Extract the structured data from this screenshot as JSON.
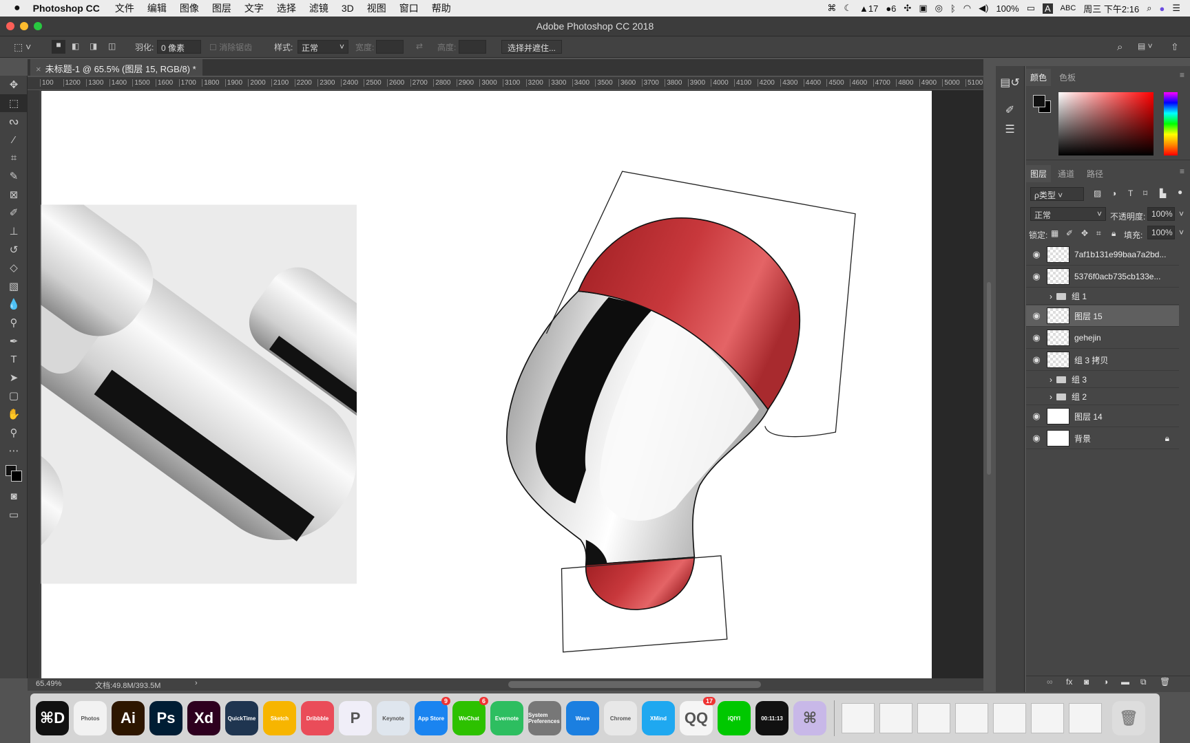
{
  "menubar": {
    "app": "Photoshop CC",
    "items": [
      "文件",
      "编辑",
      "图像",
      "图层",
      "文字",
      "选择",
      "滤镜",
      "3D",
      "视图",
      "窗口",
      "帮助"
    ],
    "status": {
      "notifications": "17",
      "wechat": "6",
      "battery": "100%",
      "input": "ABC",
      "clock": "周三 下午2:16"
    }
  },
  "window": {
    "title": "Adobe Photoshop CC 2018"
  },
  "options": {
    "feather_label": "羽化:",
    "feather_value": "0 像素",
    "antialias_label": "消除锯齿",
    "style_label": "样式:",
    "style_value": "正常",
    "width_label": "宽度:",
    "height_label": "高度:",
    "select_mask_button": "选择并遮住..."
  },
  "document": {
    "tab": "未标题-1 @ 65.5% (图层 15, RGB/8) *",
    "zoom": "65.49%",
    "doc_size": "文档:49.8M/393.5M",
    "status_arrow": "›"
  },
  "ruler": {
    "labels": [
      "100",
      "1200",
      "1300",
      "1400",
      "1500",
      "1600",
      "1700",
      "1800",
      "1900",
      "2000",
      "2100",
      "2200",
      "2300",
      "2400",
      "2500",
      "2600",
      "2700",
      "2800",
      "2900",
      "3000",
      "3100",
      "3200",
      "3300",
      "3400",
      "3500",
      "3600",
      "3700",
      "3800",
      "3900",
      "4000",
      "4100",
      "4200",
      "4300",
      "4400",
      "4500",
      "4600",
      "4700",
      "4800",
      "4900",
      "5000",
      "5100"
    ]
  },
  "tools": [
    "move",
    "rect-marquee",
    "lasso",
    "magic-wand",
    "crop",
    "eyedropper",
    "frame",
    "brush",
    "stamp",
    "history-brush",
    "eraser",
    "gradient",
    "blur",
    "dodge",
    "pen",
    "type",
    "path-select",
    "rectangle",
    "hand",
    "zoom",
    "more"
  ],
  "color_panel": {
    "tabs": [
      "颜色",
      "色板"
    ],
    "foreground": "#111111",
    "background": "#000000",
    "hue": "#ff0000"
  },
  "layers_panel": {
    "tabs": [
      "图层",
      "通道",
      "路径"
    ],
    "filter": "ρ类型",
    "blend_mode": "正常",
    "opacity_label": "不透明度:",
    "opacity": "100%",
    "lock_label": "锁定:",
    "fill_label": "填充:",
    "fill": "100%",
    "layers": [
      {
        "name": "7af1b131e99baa7a2bd...",
        "visible": true,
        "kind": "smart"
      },
      {
        "name": "5376f0acb735cb133e...",
        "visible": true,
        "kind": "smart"
      },
      {
        "name": "组 1",
        "visible": false,
        "kind": "group"
      },
      {
        "name": "图层 15",
        "visible": true,
        "kind": "layer",
        "selected": true
      },
      {
        "name": "gehejin",
        "visible": true,
        "kind": "layer"
      },
      {
        "name": "组 3 拷贝",
        "visible": true,
        "kind": "layer"
      },
      {
        "name": "组 3",
        "visible": false,
        "kind": "group"
      },
      {
        "name": "组 2",
        "visible": false,
        "kind": "group"
      },
      {
        "name": "图层 14",
        "visible": true,
        "kind": "layer"
      },
      {
        "name": "背景",
        "visible": true,
        "kind": "layer",
        "locked": true
      }
    ]
  },
  "dock": {
    "apps": [
      {
        "name": "⌘D",
        "color": "#111"
      },
      {
        "name": "Photos",
        "color": "#f2f2f2"
      },
      {
        "name": "Ai",
        "color": "#2d1600"
      },
      {
        "name": "Ps",
        "color": "#001d34"
      },
      {
        "name": "Xd",
        "color": "#2e001f"
      },
      {
        "name": "QuickTime",
        "color": "#1f3550"
      },
      {
        "name": "Sketch",
        "color": "#f7b500"
      },
      {
        "name": "Dribbble",
        "color": "#ea4c59"
      },
      {
        "name": "P",
        "color": "#f0eef8"
      },
      {
        "name": "Keynote",
        "color": "#dfe6ee"
      },
      {
        "name": "App Store",
        "color": "#1a84f0",
        "badge": "9"
      },
      {
        "name": "WeChat",
        "color": "#2dc100",
        "badge": "6"
      },
      {
        "name": "Evernote",
        "color": "#2dbe60"
      },
      {
        "name": "System Preferences",
        "color": "#777"
      },
      {
        "name": "Wave",
        "color": "#1b7fe0"
      },
      {
        "name": "Chrome",
        "color": "#e8e8e8"
      },
      {
        "name": "XMind",
        "color": "#1fa8f0"
      },
      {
        "name": "QQ",
        "color": "#f5f5f5",
        "badge": "17"
      },
      {
        "name": "iQIYI",
        "color": "#00c800"
      },
      {
        "name": "00:11:13",
        "color": "#111"
      },
      {
        "name": "⌘",
        "color": "#c8b8e8"
      }
    ],
    "thumbnails": 7,
    "trash": "Trash"
  }
}
